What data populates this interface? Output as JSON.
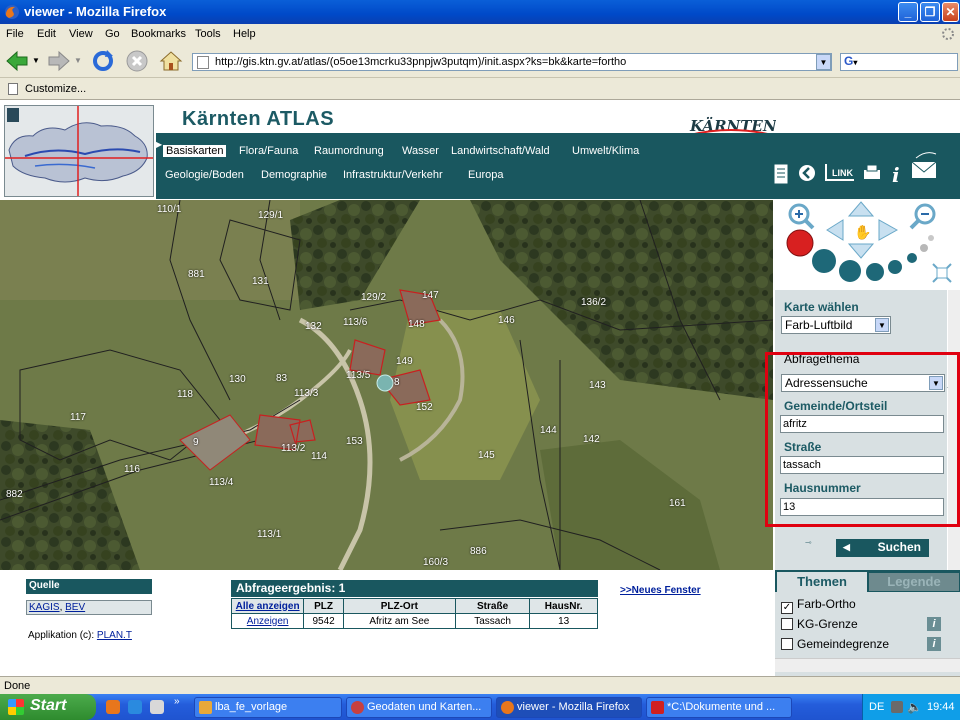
{
  "window": {
    "title": "viewer - Mozilla Firefox"
  },
  "menu": [
    "File",
    "Edit",
    "View",
    "Go",
    "Bookmarks",
    "Tools",
    "Help"
  ],
  "url": "http://gis.ktn.gv.at/atlas/(o5oe13mcrku33pnpjw3putqm)/init.aspx?ks=bk&karte=fortho",
  "bookmarks": {
    "customize": "Customize..."
  },
  "header": {
    "title": "Kärnten ATLAS",
    "logo_text": "KÄRNTEN",
    "link_label": "LINK",
    "tabs_row1": [
      "Basiskarten",
      "Flora/Fauna",
      "Raumordnung",
      "Wasser",
      "Landwirtschaft/Wald",
      "Umwelt/Klima"
    ],
    "tabs_row2": [
      "Geologie/Boden",
      "Demographie",
      "Infrastruktur/Verkehr",
      "Europa"
    ]
  },
  "map": {
    "plot_labels": [
      "110/1",
      "129/1",
      "881",
      "131",
      "129/2",
      "147",
      "132",
      "113/6",
      "148",
      "146",
      "136/2",
      "149",
      "113/5",
      "8",
      "130",
      "83",
      "143",
      "118",
      "113/3",
      "152",
      "117",
      "144",
      "142",
      "9",
      "153",
      "113/2",
      "114",
      "145",
      "116",
      "113/4",
      "882",
      "161",
      "113/1",
      "886",
      "160/3"
    ]
  },
  "sidebar": {
    "karte_label": "Karte wählen",
    "karte_value": "Farb-Luftbild",
    "thema_label": "Abfragethema",
    "thema_value": "Adressensuche",
    "gemeinde_label": "Gemeinde/Ortsteil",
    "gemeinde_value": "afritz",
    "strasse_label": "Straße",
    "strasse_value": "tassach",
    "haus_label": "Hausnummer",
    "haus_value": "13",
    "search_button": "Suchen"
  },
  "source": {
    "heading": "Quelle",
    "link1": "KAGIS",
    "sep": ",",
    "link2": "BEV",
    "app_text": "Applikation (c):",
    "app_link": "PLAN.T"
  },
  "result": {
    "heading": "Abfrageergebnis: 1",
    "header_link": "Alle anzeigen",
    "columns": [
      "PLZ",
      "PLZ-Ort",
      "Straße",
      "HausNr."
    ],
    "row": {
      "action": "Anzeigen",
      "plz": "9542",
      "ort": "Afritz am See",
      "strasse": "Tassach",
      "hausnr": "13"
    },
    "new_window": ">>Neues Fenster"
  },
  "layers": {
    "themen_tab": "Themen",
    "legende_tab": "Legende",
    "items": [
      {
        "label": "Farb-Ortho",
        "checked": true
      },
      {
        "label": "KG-Grenze",
        "checked": false
      },
      {
        "label": "Gemeindegrenze",
        "checked": false
      }
    ]
  },
  "status": "Done",
  "taskbar": {
    "start": "Start",
    "tasks": [
      "lba_fe_vorlage",
      "Geodaten und Karten...",
      "viewer - Mozilla Firefox",
      "*C:\\Dokumente und ..."
    ],
    "lang": "DE",
    "clock": "19:44"
  },
  "colors": {
    "accent": "#19575f",
    "highlight_frame": "#e00010"
  }
}
